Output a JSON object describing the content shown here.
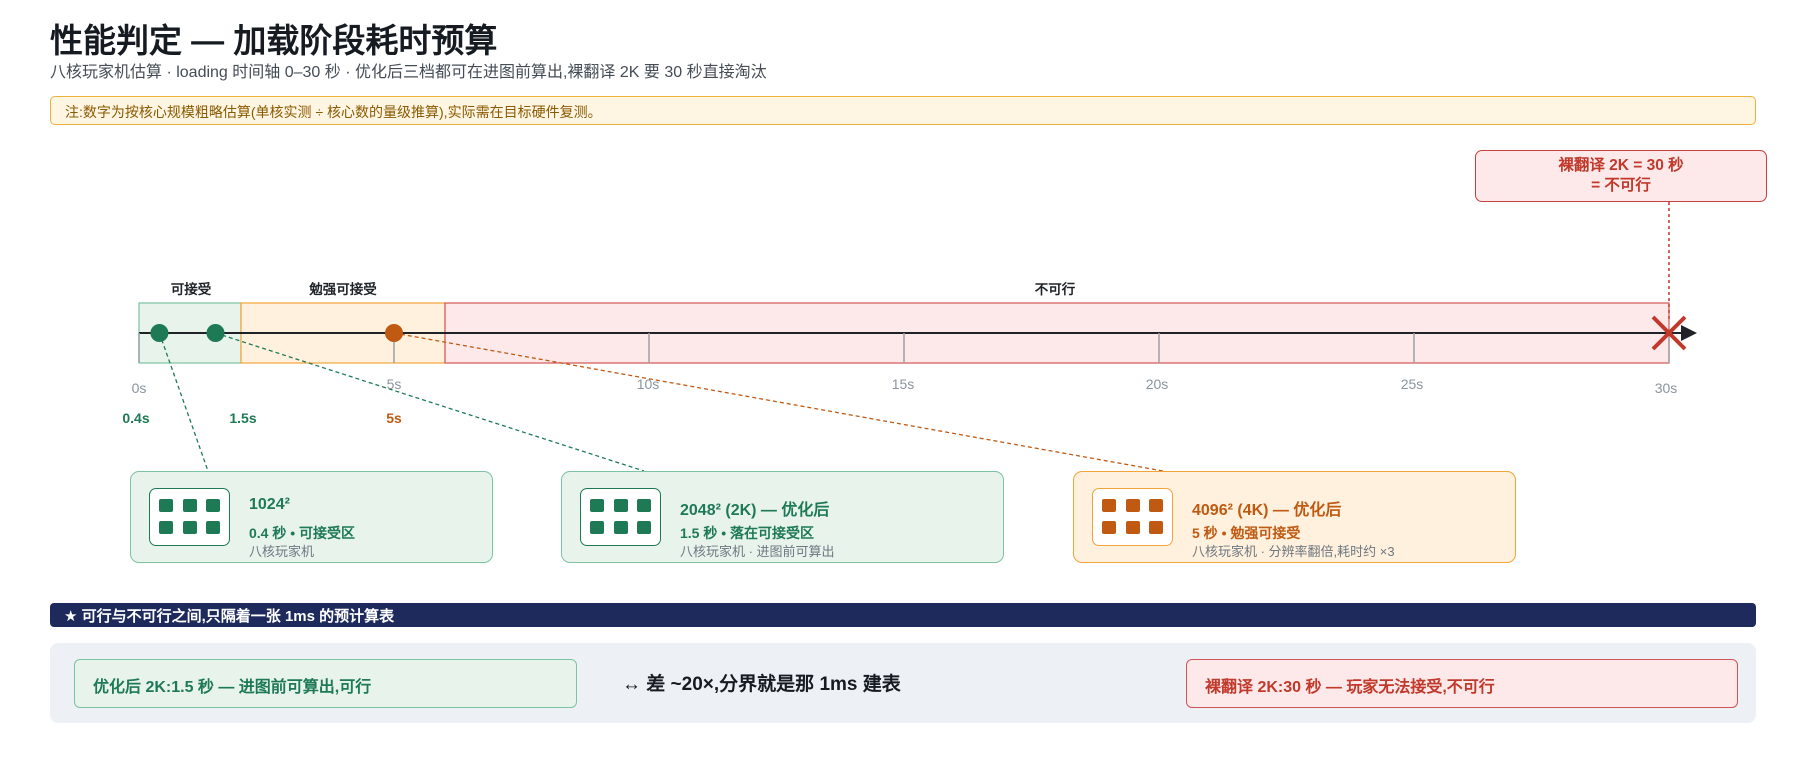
{
  "header": {
    "title": "性能判定 — 加载阶段耗时预算",
    "subtitle": "八核玩家机估算 · loading 时间轴 0–30 秒 · 优化后三档都可在进图前算出,裸翻译 2K 要 30 秒直接淘汰"
  },
  "note": "注:数字为按核心规模粗略估算(单核实测 ÷ 核心数的量级推算),实际需在目标硬件复测。",
  "timeline": {
    "zones": [
      {
        "label": "可接受",
        "from": 0,
        "to": 2,
        "color": "#1e7a55"
      },
      {
        "label": "勉强可接受",
        "from": 2,
        "to": 6,
        "color": "#c05a13"
      },
      {
        "label": "不可行",
        "from": 6,
        "to": 30,
        "color": "#c0392b"
      }
    ],
    "ticks": [
      "0s",
      "5s",
      "10s",
      "15s",
      "20s",
      "25s",
      "30s"
    ],
    "points": [
      {
        "label": "0.4s",
        "value": 0.4,
        "color": "#1e7a55"
      },
      {
        "label": "1.5s",
        "value": 1.5,
        "color": "#1e7a55"
      },
      {
        "label": "5s",
        "value": 5,
        "color": "#c05a13"
      }
    ],
    "fail_marker": {
      "value": 30,
      "line1": "裸翻译 2K = 30 秒",
      "line2": "= 不可行"
    }
  },
  "cards": [
    {
      "title": "1024²",
      "line2": "0.4 秒 • 可接受区",
      "line3": "八核玩家机",
      "tone": "green"
    },
    {
      "title": "2048² (2K) — 优化后",
      "line2": "1.5 秒 • 落在可接受区",
      "line3": "八核玩家机 · 进图前可算出",
      "tone": "green"
    },
    {
      "title": "4096² (4K) — 优化后",
      "line2": "5 秒 • 勉强可接受",
      "line3": "八核玩家机 · 分辨率翻倍,耗时约 ×3",
      "tone": "orange"
    }
  ],
  "banner": "★ 可行与不可行之间,只隔着一张 1ms 的预计算表",
  "compare": {
    "good": "优化后 2K:1.5 秒 — 进图前可算出,可行",
    "diff": "↔ 差 ~20×,分界就是那 1ms 建表",
    "bad": "裸翻译 2K:30 秒 — 玩家无法接受,不可行"
  },
  "colors": {
    "green": "#1e7a55",
    "orange": "#c05a13",
    "red": "#c0392b",
    "navy": "#1f2a5c"
  }
}
